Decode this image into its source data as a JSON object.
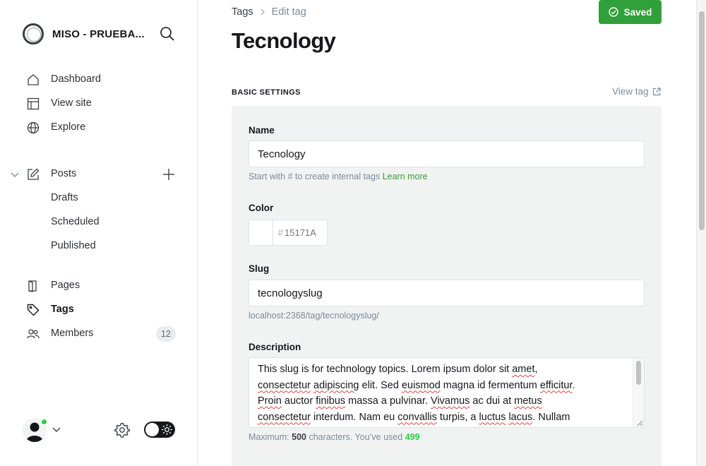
{
  "sidebar": {
    "brand_name": "MISO - PRUEBA...",
    "nav": [
      {
        "label": "Dashboard",
        "icon": "home-icon"
      },
      {
        "label": "View site",
        "icon": "layout-icon"
      },
      {
        "label": "Explore",
        "icon": "globe-icon"
      }
    ],
    "posts": {
      "label": "Posts",
      "icon": "pencil-icon",
      "subitems": [
        "Drafts",
        "Scheduled",
        "Published"
      ]
    },
    "secondary": [
      {
        "label": "Pages",
        "icon": "page-icon"
      },
      {
        "label": "Tags",
        "icon": "tag-icon",
        "active": true
      },
      {
        "label": "Members",
        "icon": "members-icon",
        "count": "12"
      }
    ]
  },
  "main": {
    "breadcrumb": {
      "parent": "Tags",
      "current": "Edit tag"
    },
    "saved_label": "Saved",
    "page_title": "Tecnology",
    "section_title": "Basic settings",
    "view_tag_label": "View tag",
    "form": {
      "name_label": "Name",
      "name_value": "Tecnology",
      "name_hint": "Start with # to create internal tags",
      "name_hint_link": "Learn more",
      "color_label": "Color",
      "color_hash": "#",
      "color_value": "15171A",
      "slug_label": "Slug",
      "slug_value": "tecnologyslug",
      "slug_hint": "localhost:2368/tag/tecnologyslug/",
      "description_label": "Description",
      "description_lines": [
        [
          "This slug is for technology topics. Lorem ipsum dolor sit ",
          {
            "w": "amet"
          },
          ","
        ],
        [
          {
            "w": "consectetur"
          },
          " ",
          {
            "w": "adipiscing"
          },
          " elit. Sed ",
          {
            "w": "euismod"
          },
          " magna id fermentum ",
          {
            "w": "efficitur"
          },
          "."
        ],
        [
          {
            "w": "Proin"
          },
          " auctor ",
          {
            "w": "finibus"
          },
          " massa a pulvinar. ",
          {
            "w": "Vivamus"
          },
          " ac dui at ",
          {
            "w": "metus"
          }
        ],
        [
          {
            "w": "consectetur"
          },
          " interdum. Nam eu ",
          {
            "w": "convallis"
          },
          " turpis, a ",
          {
            "w": "luctus"
          },
          " ",
          {
            "w": "lacus"
          },
          ". Nullam"
        ]
      ],
      "desc_hint_prefix": "Maximum:",
      "desc_max": "500",
      "desc_hint_mid": "characters. You’ve used",
      "desc_used": "499"
    }
  },
  "colors": {
    "accent_green": "#30a03b",
    "used_green": "#30cf43",
    "text_dark": "#15171a",
    "muted": "#7c8b9a"
  }
}
